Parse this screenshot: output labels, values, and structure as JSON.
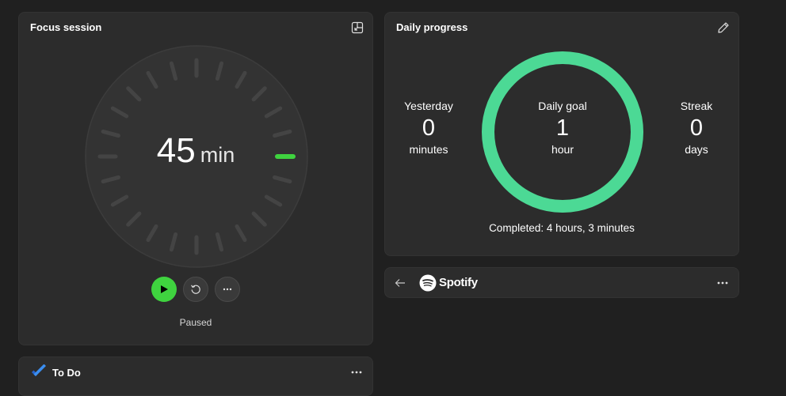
{
  "focus_session": {
    "title": "Focus session",
    "timer_value": "45",
    "timer_unit": "min",
    "status": "Paused",
    "progress_fraction": 0.0,
    "accent_color": "#3fd33f",
    "icons": {
      "expand": "expand-icon",
      "play": "play-icon",
      "reset": "reset-icon",
      "more": "more-icon"
    }
  },
  "daily_progress": {
    "title": "Daily progress",
    "yesterday": {
      "label": "Yesterday",
      "value": "0",
      "unit": "minutes"
    },
    "daily_goal": {
      "label": "Daily goal",
      "value": "1",
      "unit": "hour"
    },
    "streak": {
      "label": "Streak",
      "value": "0",
      "unit": "days"
    },
    "goal_progress_fraction": 1.0,
    "ring_color": "#4cd995",
    "completed_text": "Completed: 4 hours, 3 minutes",
    "icons": {
      "edit": "pencil-icon"
    }
  },
  "spotify": {
    "name": "Spotify",
    "icons": {
      "back": "back-arrow-icon",
      "logo": "spotify-logo-icon",
      "more": "more-icon"
    }
  },
  "todo": {
    "title": "To Do",
    "icons": {
      "logo": "todo-check-icon",
      "more": "more-icon"
    }
  }
}
